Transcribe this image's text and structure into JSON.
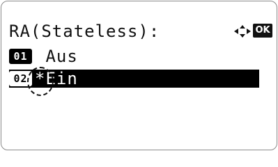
{
  "screen": {
    "title": "RA(Stateless):",
    "nav_icon": "four-way-arrow-icon",
    "ok_label": "OK"
  },
  "options": [
    {
      "number": "01",
      "label": " Aus",
      "selected": false
    },
    {
      "number": "02",
      "label": "*Ein",
      "selected": true
    }
  ]
}
